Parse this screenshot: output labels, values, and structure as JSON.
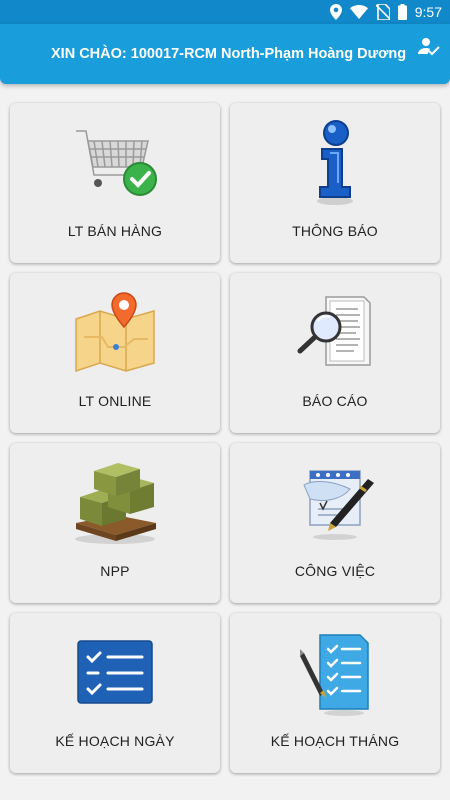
{
  "status_bar": {
    "time": "9:57",
    "icons": [
      "location-icon",
      "wifi-icon",
      "no-sim-icon",
      "battery-icon"
    ]
  },
  "app_bar": {
    "title": "XIN CHÀO: 100017-RCM North-Phạm Hoàng Dương",
    "action_icon": "user-check-icon"
  },
  "colors": {
    "status_bar": "#1188c9",
    "app_bar": "#1a9ddb",
    "tile_bg": "#eeeeee",
    "page_bg": "#f2f2f2"
  },
  "menu": [
    {
      "label": "LT BÁN HÀNG",
      "icon": "shopping-cart-check-icon"
    },
    {
      "label": "THÔNG BÁO",
      "icon": "info-icon"
    },
    {
      "label": "LT ONLINE",
      "icon": "map-pin-icon"
    },
    {
      "label": "BÁO CÁO",
      "icon": "report-magnifier-icon"
    },
    {
      "label": "NPP",
      "icon": "boxes-pallet-icon"
    },
    {
      "label": "CÔNG VIỆC",
      "icon": "document-pen-icon"
    },
    {
      "label": "KẾ HOẠCH NGÀY",
      "icon": "checklist-icon"
    },
    {
      "label": "KẾ HOẠCH THÁNG",
      "icon": "checklist-pen-icon"
    }
  ]
}
